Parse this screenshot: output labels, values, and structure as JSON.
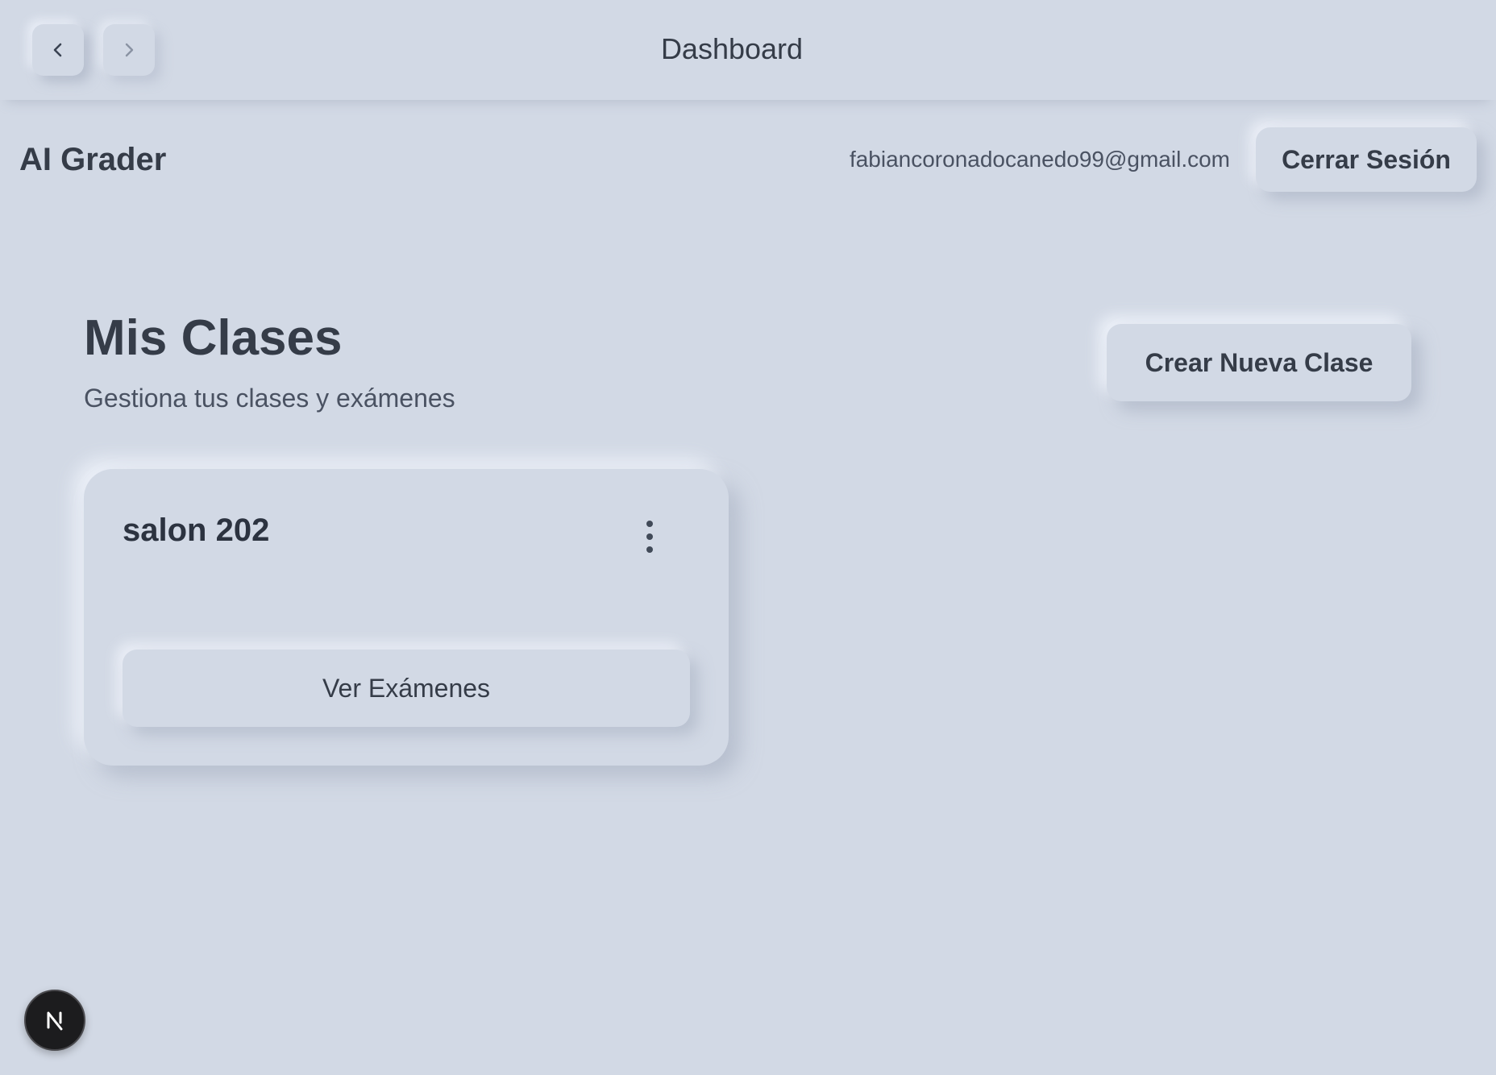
{
  "window": {
    "title": "Dashboard",
    "back_icon": "chevron-left-icon",
    "forward_icon": "chevron-right-icon"
  },
  "header": {
    "brand": "AI Grader",
    "user_email": "fabiancoronadocanedo99@gmail.com",
    "logout_label": "Cerrar Sesión"
  },
  "main": {
    "title": "Mis Clases",
    "subtitle": "Gestiona tus clases y exámenes",
    "create_label": "Crear Nueva Clase",
    "classes": [
      {
        "name": "salon 202",
        "menu_icon": "more-vertical-icon",
        "action_label": "Ver Exámenes"
      }
    ]
  },
  "dev_badge": {
    "icon": "nextjs-logo-icon"
  },
  "colors": {
    "background": "#d2d9e5",
    "text": "#353c48",
    "muted_text": "#4a5262",
    "badge": "#1c1c1e"
  }
}
